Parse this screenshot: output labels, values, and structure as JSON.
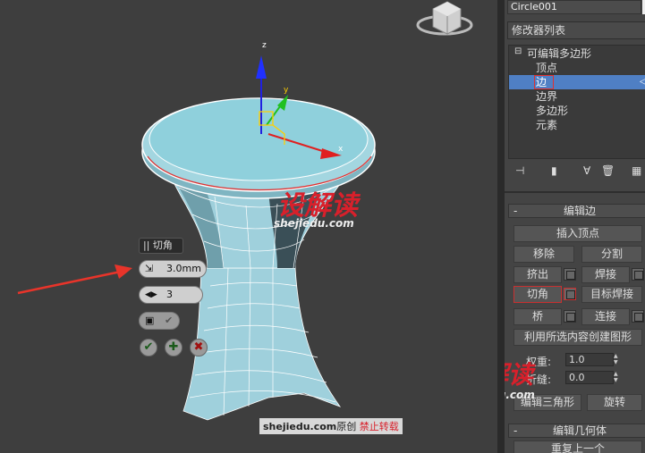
{
  "viewport": {
    "axis_labels": {
      "z": "z",
      "y": "y",
      "x": "x"
    },
    "caddy": {
      "title": "切角",
      "amount": "3.0mm",
      "segments": "3",
      "ok_icon": "check-icon",
      "apply_icon": "plus-icon",
      "cancel_icon": "x-icon"
    },
    "watermark": {
      "brand": "设解读",
      "site": "shejiedu.com"
    },
    "credit": {
      "site": "shejiedu.com",
      "text": "原创",
      "notice": "禁止转载"
    }
  },
  "panel": {
    "object_name": "Circle001",
    "modifier_list_label": "修改器列表",
    "stack": {
      "root": "可编辑多边形",
      "items": [
        "顶点",
        "边",
        "边界",
        "多边形",
        "元素"
      ],
      "selected_index": 1
    },
    "edit_edges": {
      "title": "编辑边",
      "insert_vertex": "插入顶点",
      "remove": "移除",
      "split": "分割",
      "extrude": "挤出",
      "weld": "焊接",
      "chamfer": "切角",
      "target_weld": "目标焊接",
      "bridge": "桥",
      "connect": "连接",
      "create_shape": "利用所选内容创建图形",
      "weight_label": "权重:",
      "weight_value": "1.0",
      "crease_label": "折缝:",
      "crease_value": "0.0",
      "edit_tri": "编辑三角形",
      "turn": "旋转"
    },
    "edit_geometry": {
      "title": "编辑几何体",
      "repeat_last": "重复上一个"
    },
    "minus": "-"
  },
  "colors": {
    "accent_selection": "#4f7fc4",
    "highlight_red": "#d8202b",
    "mesh": "#9fd0dc"
  }
}
